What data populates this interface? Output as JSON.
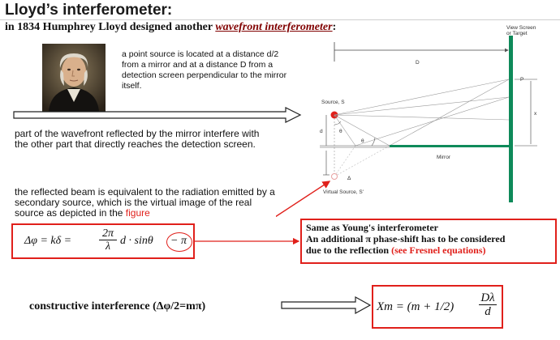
{
  "slide": {
    "title": "Lloyd’s interferometer:",
    "subtitle_prefix": "in 1834 Humphrey Lloyd designed another",
    "subtitle_emphasis": "wavefront interferometer",
    "subtitle_suffix": ":",
    "point_source_text": "a point source is located at a distance d/2 from a mirror and at a distance D from a detection screen perpendicular to the mirror itself.",
    "wavefront_text": "part of the wavefront reflected by the mirror interfere with the other part that directly reaches the detection screen.",
    "reflected_text": "the reflected beam is equivalent to the radiation emitted by a secondary source, which is the virtual image of the real source as depicted in the",
    "figure_word": "figure",
    "formula1": {
      "lhs": "Δφ = kδ =",
      "num": "2π",
      "den": "λ",
      "rhs": "d · sinθ",
      "circled": "− π"
    },
    "note_line1": "Same as Young's interferometer",
    "note_line2": "An additional π phase-shift has to be considered",
    "note_line3": "due to the reflection",
    "note_red": "(see Fresnel equations)",
    "constructive_label": "constructive interference (Δφ/2=mπ)",
    "formula2": {
      "lhs": "Xm = (m + 1/2)",
      "num": "Dλ",
      "den": "d"
    }
  },
  "diagram": {
    "screen_label_line1": "View Screen",
    "screen_label_line2": "or Target",
    "D_label": "D",
    "P_label": "P",
    "x_label": "x",
    "source_label": "Source, S",
    "d_label": "d",
    "theta1": "θ",
    "theta2": "θ",
    "delta_label": "Δ",
    "mirror_label": "Mirror",
    "virtual_label": "Virtual Source, S'"
  },
  "colors": {
    "accent_red": "#e0201b",
    "title_subtitle_emphasis": "#800000",
    "screen_green": "#0e8a5a"
  }
}
